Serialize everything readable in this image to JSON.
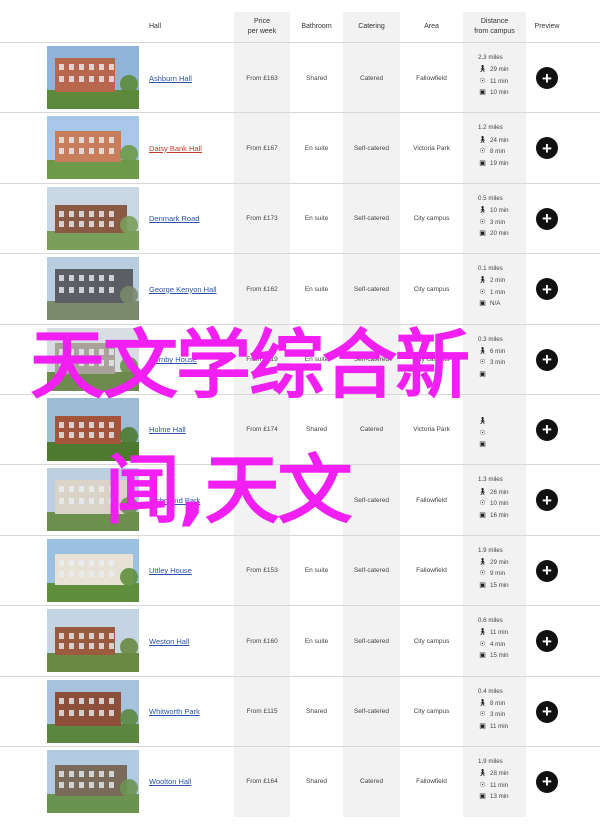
{
  "header": {
    "hall": "Hall",
    "price": "Price\nper week",
    "bathroom": "Bathroom",
    "catering": "Catering",
    "area": "Area",
    "distance": "Distance\nfrom campus",
    "preview": "Preview"
  },
  "rows": [
    {
      "name": "Ashburn Hall",
      "price": "From £163",
      "bathroom": "Shared",
      "catering": "Catered",
      "area": "Fallowfield",
      "dist": "2.3 miles",
      "walk": "29 min",
      "cycle": "11 min",
      "bus": "10 min",
      "preview": "+"
    },
    {
      "name": "Daisy Bank Hall",
      "price": "From £167",
      "bathroom": "En suite",
      "catering": "Self-catered",
      "area": "Victoria Park",
      "dist": "1.2 miles",
      "walk": "24 min",
      "cycle": "8 min",
      "bus": "19 min",
      "preview": "+"
    },
    {
      "name": "Denmark Road",
      "price": "From £173",
      "bathroom": "En suite",
      "catering": "Self-catered",
      "area": "City campus",
      "dist": "0.5 miles",
      "walk": "10 min",
      "cycle": "3 min",
      "bus": "20 min",
      "preview": "+"
    },
    {
      "name": "George Kenyon Hall",
      "price": "From £162",
      "bathroom": "En suite",
      "catering": "Self-catered",
      "area": "City campus",
      "dist": "0.1 miles",
      "walk": "2 min",
      "cycle": "1 min",
      "bus": "N/A",
      "preview": "+"
    },
    {
      "name": "Hornby House",
      "price": "From £219",
      "bathroom": "En suite",
      "catering": "Self-catered",
      "area": "City campus",
      "dist": "0.3 miles",
      "walk": "6 min",
      "cycle": "3 min",
      "bus": "",
      "preview": "+"
    },
    {
      "name": "Hulme Hall",
      "price": "From £174",
      "bathroom": "Shared",
      "catering": "Catered",
      "area": "Victoria Park",
      "dist": "",
      "walk": "",
      "cycle": "",
      "bus": "",
      "preview": "+"
    },
    {
      "name": "Richmond Park",
      "price": "",
      "bathroom": "",
      "catering": "Self-catered",
      "area": "Fallowfield",
      "dist": "1.3 miles",
      "walk": "26 min",
      "cycle": "10 min",
      "bus": "16 min",
      "preview": "+"
    },
    {
      "name": "Uttley House",
      "price": "From £153",
      "bathroom": "En suite",
      "catering": "Self-catered",
      "area": "Fallowfield",
      "dist": "1.9 miles",
      "walk": "29 min",
      "cycle": "9 min",
      "bus": "15 min",
      "preview": "+"
    },
    {
      "name": "Weston Hall",
      "price": "From £160",
      "bathroom": "En suite",
      "catering": "Self-catered",
      "area": "City campus",
      "dist": "0.6 miles",
      "walk": "11 min",
      "cycle": "4 min",
      "bus": "15 min",
      "preview": "+"
    },
    {
      "name": "Whitworth Park",
      "price": "From £115",
      "bathroom": "Shared",
      "catering": "Self-catered",
      "area": "City campus",
      "dist": "0.4 miles",
      "walk": "8 min",
      "cycle": "3 min",
      "bus": "11 min",
      "preview": "+"
    },
    {
      "name": "Woolton Hall",
      "price": "From £164",
      "bathroom": "Shared",
      "catering": "Catered",
      "area": "Fallowfield",
      "dist": "1.9 miles",
      "walk": "28 min",
      "cycle": "11 min",
      "bus": "13 min",
      "preview": "+"
    }
  ],
  "overlay": {
    "line1": "天文学综合新",
    "line2": "闻,天文"
  },
  "colors": {
    "overlay": "#f21ff2",
    "link": "#2b54a8",
    "link_visited": "#c0392b",
    "shade": "#f2f2f2"
  }
}
